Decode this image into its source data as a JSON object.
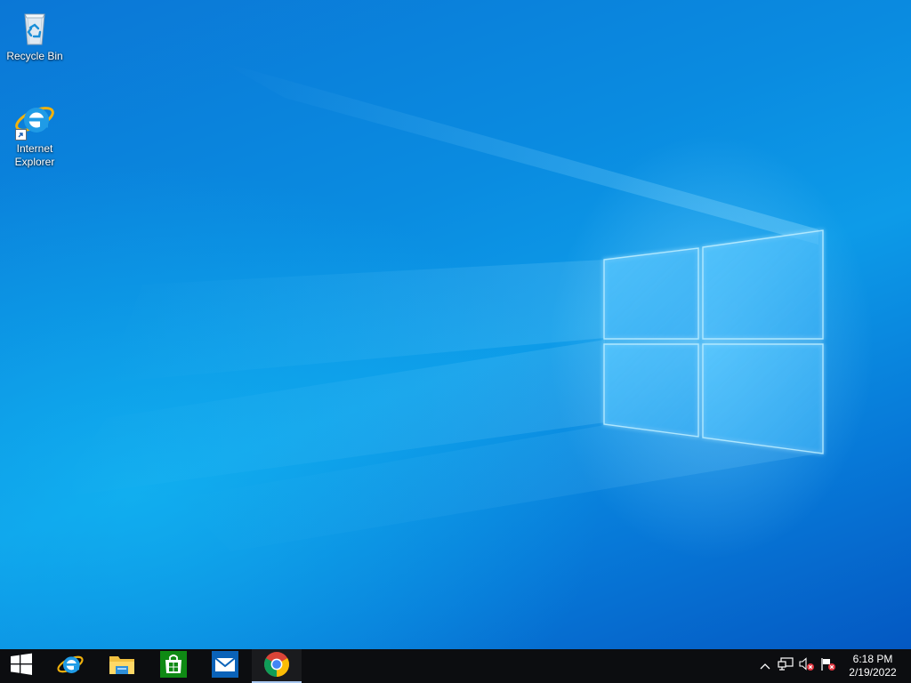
{
  "desktop": {
    "wallpaper": "windows-10-hero",
    "colors": {
      "wallpaper_top": "#0b77d6",
      "wallpaper_mid": "#0d9be8",
      "wallpaper_bottom": "#0458c2",
      "taskbar": "#0c0d10",
      "active_indicator": "#a8c7ef"
    },
    "icons": [
      {
        "label": "Recycle Bin",
        "icon": "recycle-bin-icon"
      },
      {
        "label": "Internet Explorer",
        "icon": "internet-explorer-icon",
        "shortcut": true
      }
    ]
  },
  "taskbar": {
    "start": {
      "icon": "windows-start-icon"
    },
    "pinned": [
      {
        "app": "Internet Explorer",
        "icon": "internet-explorer-icon",
        "active": false
      },
      {
        "app": "File Explorer",
        "icon": "file-explorer-icon",
        "active": false
      },
      {
        "app": "Microsoft Store",
        "icon": "store-icon",
        "active": false
      },
      {
        "app": "Mail",
        "icon": "mail-icon",
        "active": false
      },
      {
        "app": "Google Chrome",
        "icon": "chrome-icon",
        "active": true
      }
    ],
    "tray": {
      "icons": [
        "show-hidden-icons-chevron-icon",
        "network-icon",
        "volume-muted-icon",
        "action-center-flag-icon"
      ],
      "clock": {
        "time": "6:18 PM",
        "date": "2/19/2022"
      }
    }
  }
}
